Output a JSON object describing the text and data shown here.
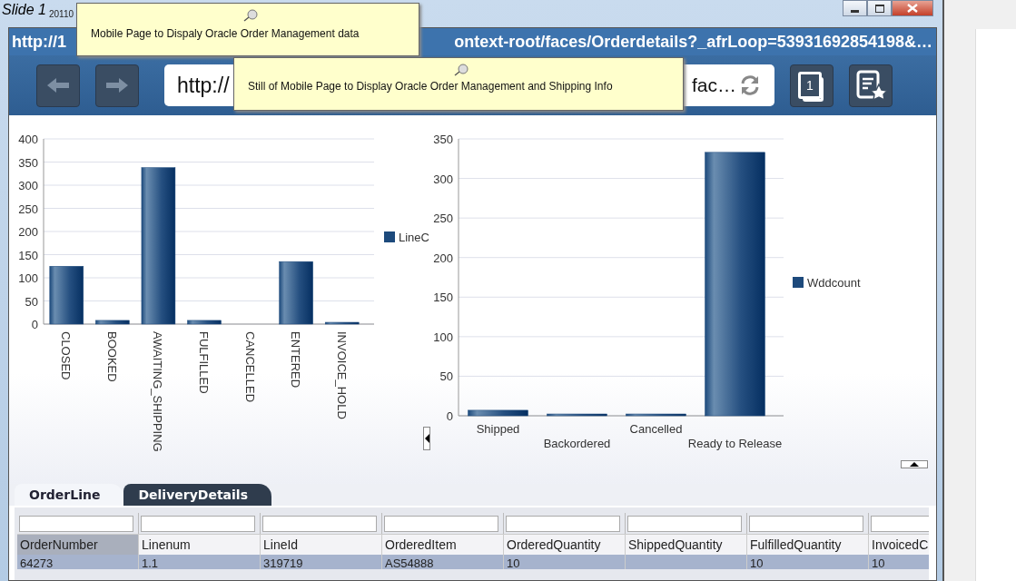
{
  "slide_label": "Slide 1",
  "window": {
    "title": "20110"
  },
  "header": {
    "url_start": "http://1",
    "url_end": "ontext-root/faces/Orderdetails?_afrLoop=53931692854198&…"
  },
  "toolbar": {
    "address_start": "http://",
    "address_end": "fac…",
    "tab_count": "1"
  },
  "notes": [
    {
      "text": "Mobile Page to Dispaly Oracle Order Management data"
    },
    {
      "text": "Still of Mobile Page to Display Oracle Order Management and Shipping Info"
    }
  ],
  "charts": [
    {
      "chart_data": {
        "type": "bar",
        "categories": [
          "CLOSED",
          "BOOKED",
          "AWAITING_SHIPPING",
          "FULFILLED",
          "CANCELLED",
          "ENTERED",
          "INVOICE_HOLD"
        ],
        "series": [
          {
            "name": "LineC",
            "color": "#1d4a7c",
            "values": [
              125,
              8,
              338,
              8,
              0,
              135,
              3
            ]
          }
        ],
        "ylim": [
          0,
          400
        ],
        "grid": true,
        "yticks": [
          0,
          50,
          100,
          150,
          200,
          250,
          300,
          350,
          400
        ]
      }
    },
    {
      "chart_data": {
        "type": "bar",
        "categories": [
          "Shipped",
          "Backordered",
          "Cancelled",
          "Ready to Release"
        ],
        "series": [
          {
            "name": "Wddcount",
            "color": "#1d4a7c",
            "values": [
              7,
              1,
              1,
              333
            ]
          }
        ],
        "ylim": [
          0,
          350
        ],
        "grid": true,
        "yticks": [
          0,
          50,
          100,
          150,
          200,
          250,
          300,
          350
        ]
      }
    }
  ],
  "tabs": [
    {
      "label": "OrderLine",
      "selected": true
    },
    {
      "label": "DeliveryDetails",
      "selected": false
    }
  ],
  "table": {
    "columns": [
      {
        "label": "OrderNumber",
        "selected": true
      },
      {
        "label": "Linenum",
        "selected": false
      },
      {
        "label": "LineId",
        "selected": false
      },
      {
        "label": "OrderedItem",
        "selected": false
      },
      {
        "label": "OrderedQuantity",
        "selected": false
      },
      {
        "label": "ShippedQuantity",
        "selected": false
      },
      {
        "label": "FulfilledQuantity",
        "selected": false
      },
      {
        "label": "InvoicedC",
        "selected": false
      }
    ],
    "rows": [
      {
        "selected": true,
        "cells": [
          "64273",
          "1.1",
          "319719",
          "AS54888",
          "10",
          null,
          "10",
          "10"
        ]
      }
    ]
  }
}
